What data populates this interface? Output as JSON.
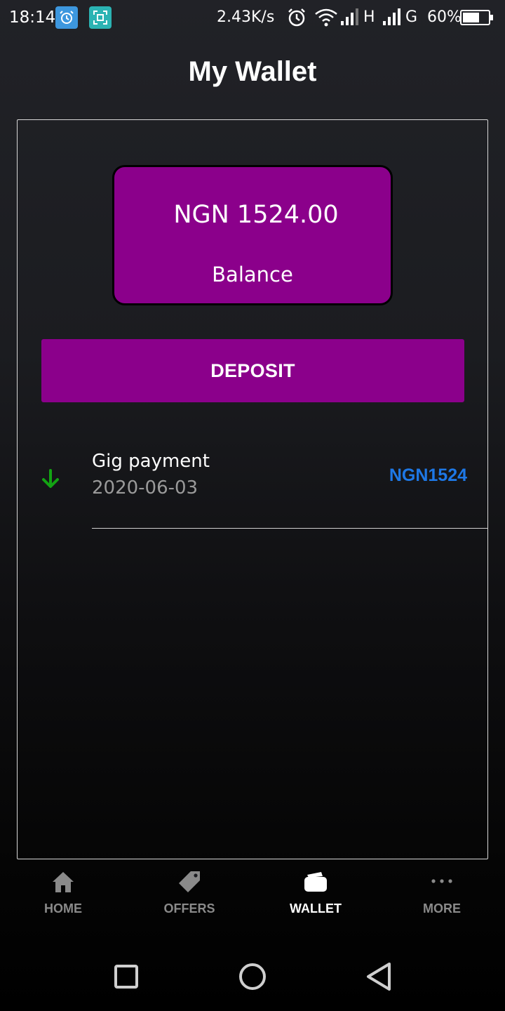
{
  "status_bar": {
    "time": "18:14",
    "network_speed": "2.43K/s",
    "signal_1_type": "H",
    "signal_2_type": "G",
    "battery": "60%",
    "icons": [
      "app-notification-icon",
      "scanner-icon",
      "alarm-icon",
      "wifi-icon",
      "signal-icon",
      "battery-icon"
    ]
  },
  "header": {
    "title": "My Wallet"
  },
  "balance": {
    "amount": "NGN 1524.00",
    "label": "Balance"
  },
  "deposit_button": {
    "label": "DEPOSIT"
  },
  "transactions": [
    {
      "title": "Gig payment",
      "date": "2020-06-03",
      "amount": "NGN1524",
      "direction": "incoming",
      "icon": "arrow-down-icon"
    }
  ],
  "bottom_nav": {
    "items": [
      {
        "label": "HOME",
        "icon": "home-icon",
        "active": false
      },
      {
        "label": "OFFERS",
        "icon": "tag-icon",
        "active": false
      },
      {
        "label": "WALLET",
        "icon": "wallet-icon",
        "active": true
      },
      {
        "label": "MORE",
        "icon": "more-icon",
        "active": false
      }
    ]
  },
  "system_nav": [
    "recents-button",
    "home-button",
    "back-button"
  ],
  "colors": {
    "accent": "#8b008b",
    "amount_blue": "#1e78e6",
    "incoming_green": "#13a313",
    "inactive_nav": "#8a8a8a"
  }
}
